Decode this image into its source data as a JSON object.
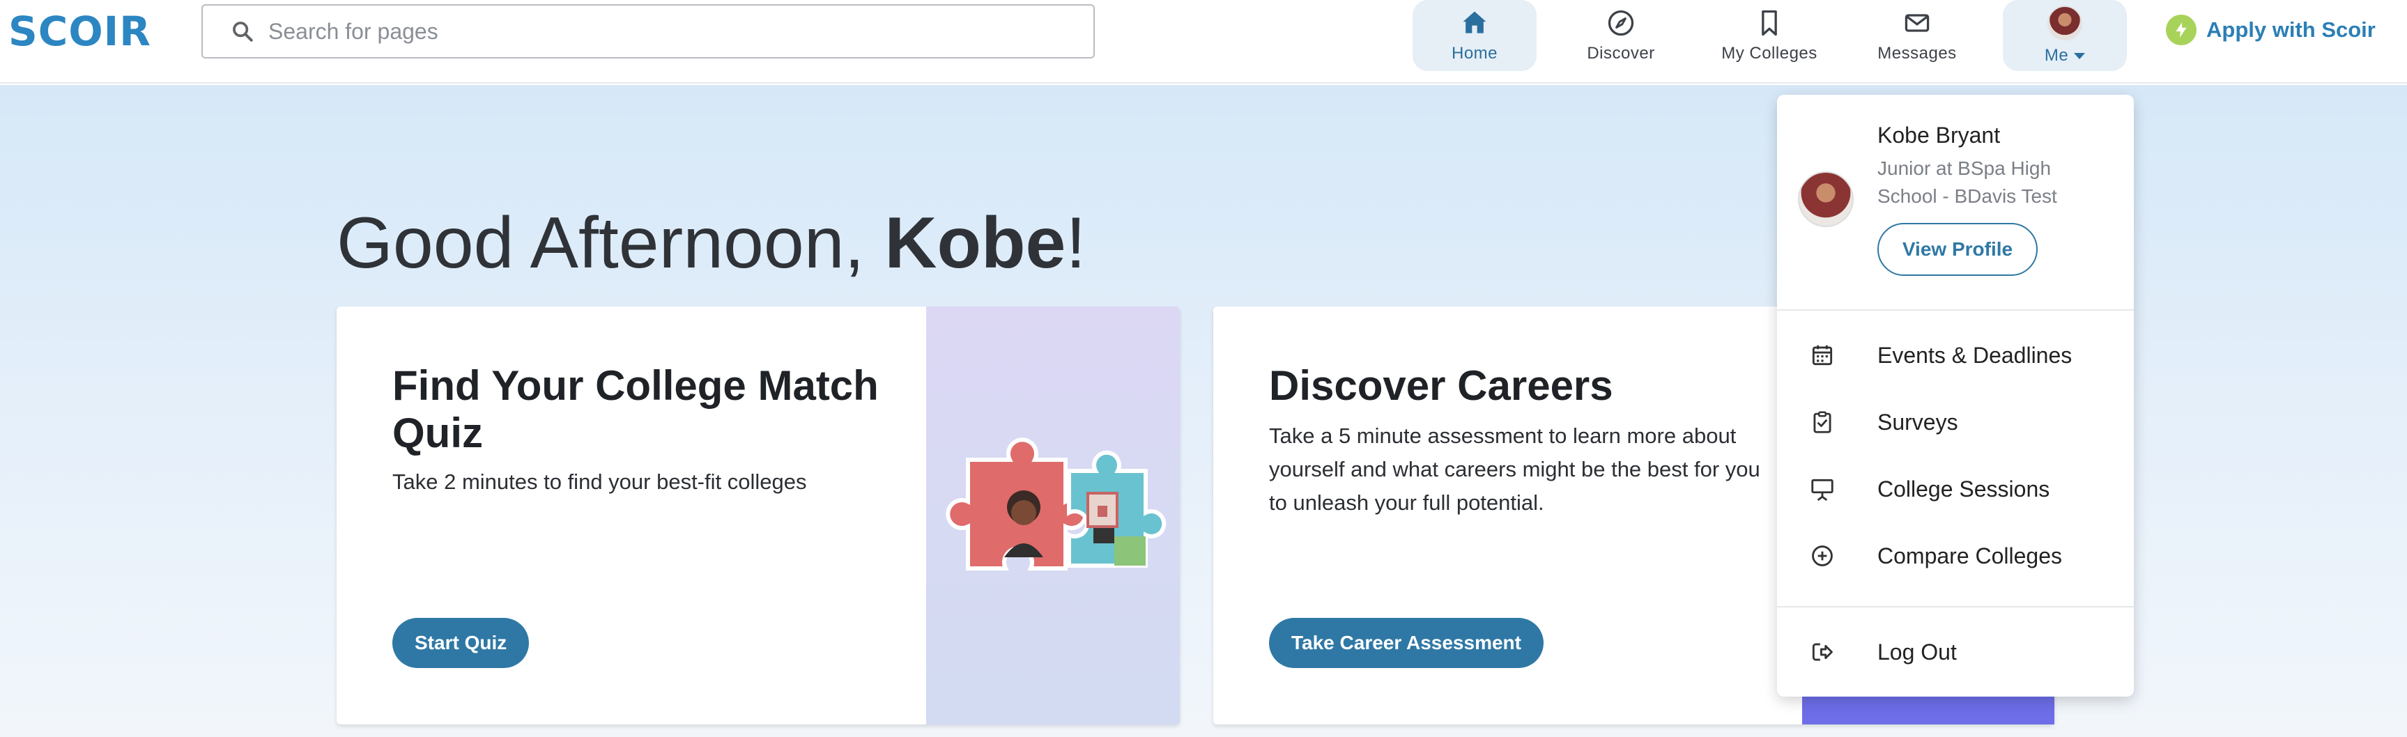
{
  "header": {
    "logo": "SCOIR",
    "search_placeholder": "Search for pages",
    "nav": [
      {
        "label": "Home",
        "icon": "home-icon",
        "active": true
      },
      {
        "label": "Discover",
        "icon": "compass-icon"
      },
      {
        "label": "My Colleges",
        "icon": "bookmark-icon"
      },
      {
        "label": "Messages",
        "icon": "envelope-icon"
      },
      {
        "label": "Me",
        "icon": "avatar"
      }
    ],
    "apply_label": "Apply with Scoir"
  },
  "main": {
    "greeting_prefix": "Good Afternoon, ",
    "greeting_name": "Kobe",
    "greeting_suffix": "!",
    "cards": [
      {
        "title": "Find Your College Match Quiz",
        "description": "Take 2 minutes to find your best-fit colleges",
        "button": "Start Quiz"
      },
      {
        "title": "Discover Careers",
        "description": "Take a 5 minute assessment to learn more about yourself and what careers might be the best for you to unleash your full potential.",
        "button": "Take Career Assessment"
      }
    ]
  },
  "dropdown": {
    "name": "Kobe Bryant",
    "subtitle": "Junior at BSpa High School - BDavis Test",
    "view_profile": "View Profile",
    "items": [
      {
        "label": "Events & Deadlines",
        "icon": "calendar-icon"
      },
      {
        "label": "Surveys",
        "icon": "clipboard-check-icon"
      },
      {
        "label": "College Sessions",
        "icon": "presentation-icon"
      },
      {
        "label": "Compare Colleges",
        "icon": "plus-circle-icon"
      }
    ],
    "logout": "Log Out"
  },
  "colors": {
    "brand": "#2c86c2",
    "button": "#2f78a5",
    "active_nav_bg": "#e6eef6",
    "bolt": "#a8d35a"
  }
}
